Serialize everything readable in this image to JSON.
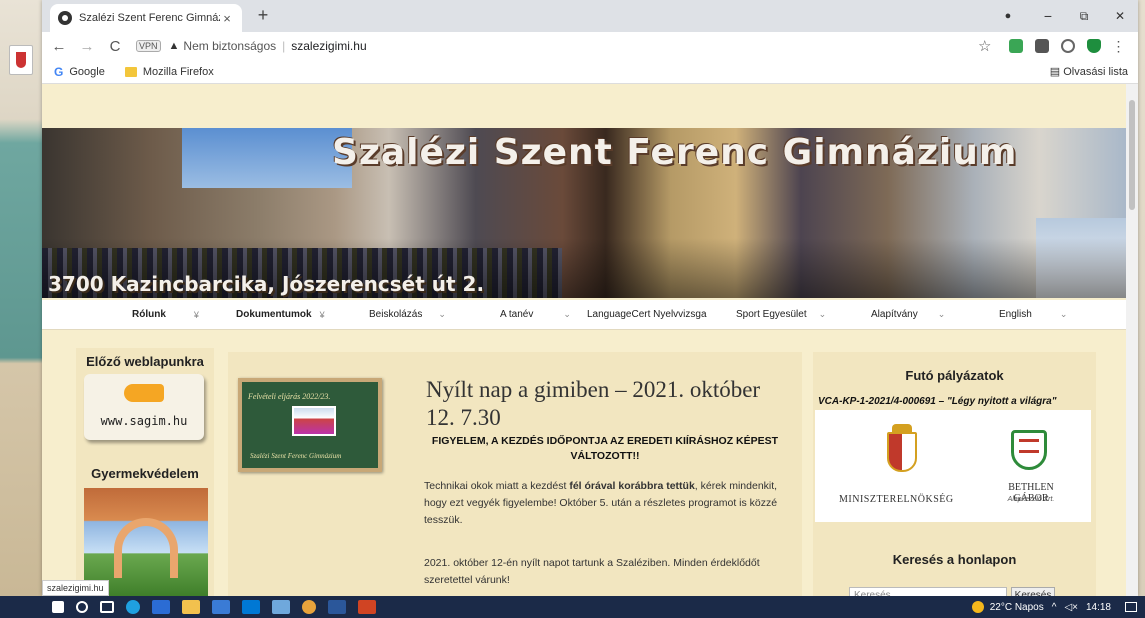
{
  "browser": {
    "tab_title": "Szalézi Szent Ferenc Gimnázium",
    "tab_close": "×",
    "new_tab": "+",
    "minimize": "−",
    "restore": "⧉",
    "close": "✕",
    "back": "←",
    "forward": "→",
    "reload": "C",
    "vpn": "VPN",
    "security_label": "Nem biztonságos",
    "url": "szalezigimi.hu",
    "star": "☆",
    "menu": "⋮",
    "bookmarks": [
      {
        "label": "Google"
      },
      {
        "label": "Mozilla Firefox"
      }
    ],
    "reading_list": "Olvasási lista",
    "status_url": "szalezigimi.hu"
  },
  "banner": {
    "title": "Szalézi Szent Ferenc Gimnázium",
    "address": "3700 Kazincbarcika, Jószerencsét út 2."
  },
  "nav": {
    "items": [
      {
        "label": "Rólunk"
      },
      {
        "label": "Dokumentumok"
      },
      {
        "label": "Beiskolázás"
      },
      {
        "label": "A tanév"
      },
      {
        "label": "LanguageCert Nyelvvizsga"
      },
      {
        "label": "Sport Egyesület"
      },
      {
        "label": "Alapítvány"
      },
      {
        "label": "English"
      }
    ]
  },
  "left": {
    "prev_heading": "Előző weblapunkra",
    "sagim": "www.sagim.hu",
    "child_heading": "Gyermekvédelem"
  },
  "article": {
    "thumb_top": "Felvételi eljárás 2022/23.",
    "thumb_bottom": "Szalézi Szent Ferenc Gimnázium",
    "title": "Nyílt nap a gimiben – 2021. október 12. 7.30",
    "warning": "FIGYELEM, A KEZDÉS IDŐPONTJA AZ EREDETI KIÍRÁSHOZ KÉPEST VÁLTOZOTT!!",
    "p1_a": "Technikai okok miatt a kezdést ",
    "p1_b": "fél órával korábbra tettük",
    "p1_c": ", kérek mindenkit, hogy ezt vegyék figyelembe! Október 5. után a részletes programot is közzé tesszük.",
    "p2": "2021. október 12-én nyílt napot tartunk a Szaléziben. Minden érdeklődőt szeretettel várunk!"
  },
  "right": {
    "heading": "Futó pályázatok",
    "vca": "VCA-KP-1-2021/4-000691 – \"Légy nyitott a világra\"",
    "logo1": "MINISZTERELNÖKSÉG",
    "logo2": "BETHLEN GÁBOR",
    "logo2_sub": "Alapkezelő Zrt.",
    "search_heading": "Keresés a honlapon",
    "search_placeholder": "Keresés …",
    "search_button": "Keresés"
  },
  "taskbar": {
    "weather": "22°C Napos",
    "time": "14:18"
  }
}
